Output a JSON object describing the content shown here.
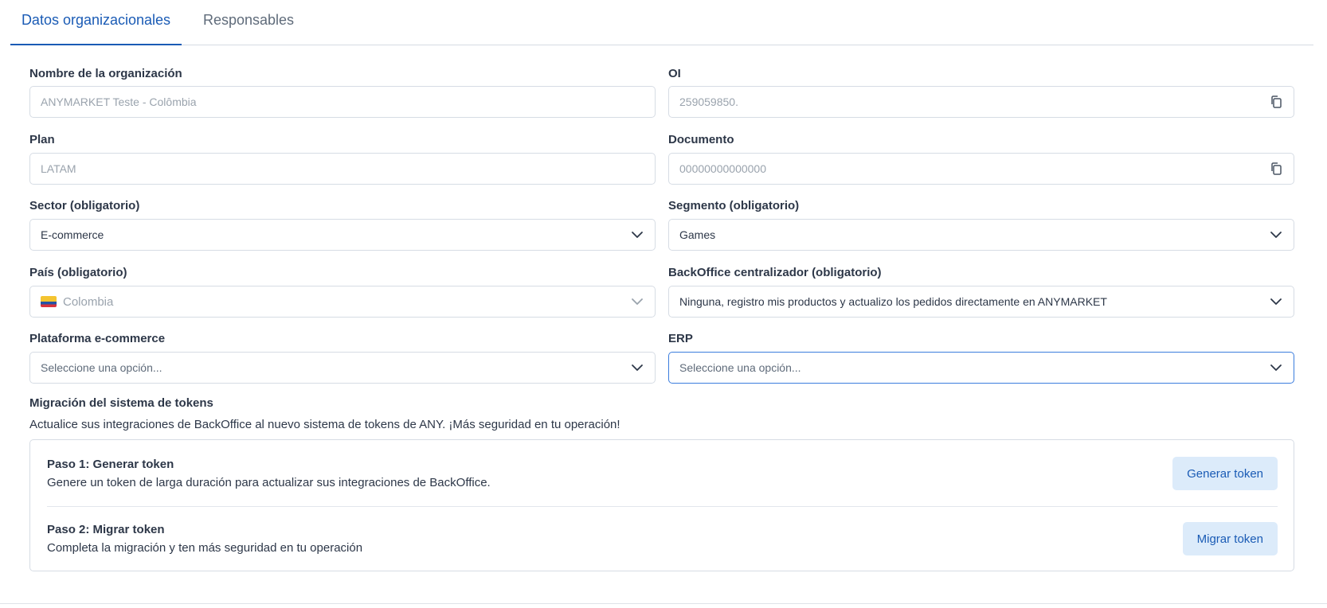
{
  "tabs": [
    {
      "label": "Datos organizacionales",
      "active": true
    },
    {
      "label": "Responsables",
      "active": false
    }
  ],
  "form": {
    "org_name": {
      "label": "Nombre de la organización",
      "value": "ANYMARKET Teste - Colômbia"
    },
    "oi": {
      "label": "OI",
      "value": "259059850.",
      "icon": "copy-icon"
    },
    "plan": {
      "label": "Plan",
      "value": "LATAM"
    },
    "documento": {
      "label": "Documento",
      "value": "00000000000000",
      "icon": "copy-icon"
    },
    "sector": {
      "label": "Sector (obligatorio)",
      "value": "E-commerce"
    },
    "segmento": {
      "label": "Segmento (obligatorio)",
      "value": "Games"
    },
    "pais": {
      "label": "País (obligatorio)",
      "value": "Colombia",
      "icon": "colombia-flag-icon"
    },
    "backoffice": {
      "label": "BackOffice centralizador (obligatorio)",
      "value": "Ninguna, registro mis productos y actualizo los pedidos directamente en ANYMARKET"
    },
    "plataforma": {
      "label": "Plataforma e-commerce",
      "placeholder": "Seleccione una opción..."
    },
    "erp": {
      "label": "ERP",
      "placeholder": "Seleccione una opción..."
    }
  },
  "migration": {
    "title": "Migración del sistema de tokens",
    "description": "Actualice sus integraciones de BackOffice al nuevo sistema de tokens de ANY. ¡Más seguridad en tu operación!",
    "steps": [
      {
        "title": "Paso 1: Generar token",
        "description": "Genere un token de larga duración para actualizar sus integraciones de BackOffice.",
        "button": "Generar token"
      },
      {
        "title": "Paso 2: Migrar token",
        "description": "Completa la migración y ten más seguridad en tu operación",
        "button": "Migrar token"
      }
    ]
  },
  "colors": {
    "accent": "#1a5bb5",
    "button_bg": "#dcebfa",
    "border": "#d6dce4",
    "focus": "#3b7ddd"
  }
}
